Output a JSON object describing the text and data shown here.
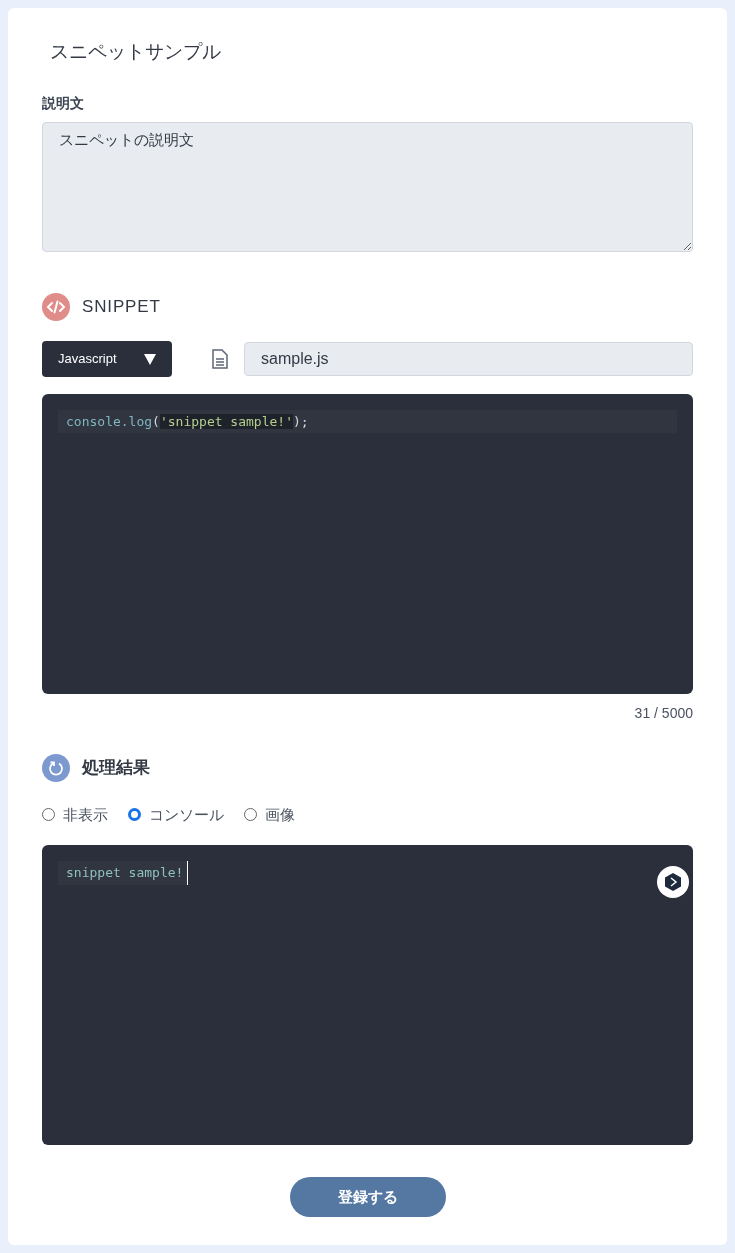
{
  "title": "スニペットサンプル",
  "description": {
    "label": "説明文",
    "value": "スニペットの説明文"
  },
  "snippet": {
    "heading": "SNIPPET",
    "language": "Javascript",
    "filename": "sample.js",
    "code": [
      {
        "kind": "func",
        "text": "console.log"
      },
      {
        "kind": "plain",
        "text": "("
      },
      {
        "kind": "string",
        "text": "'snippet sample!'"
      },
      {
        "kind": "plain",
        "text": ");"
      }
    ],
    "counter": "31 / 5000"
  },
  "result": {
    "heading": "処理結果",
    "options": [
      {
        "label": "非表示",
        "selected": false
      },
      {
        "label": "コンソール",
        "selected": true
      },
      {
        "label": "画像",
        "selected": false
      }
    ],
    "output": "snippet sample!"
  },
  "submit": "登録する"
}
